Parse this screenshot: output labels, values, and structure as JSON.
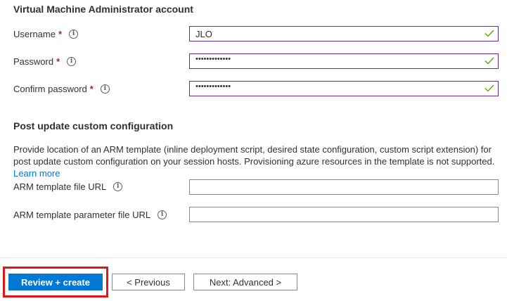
{
  "vm_admin": {
    "title": "Virtual Machine Administrator account",
    "username": {
      "label": "Username",
      "required_mark": "*",
      "value": "JLO"
    },
    "password": {
      "label": "Password",
      "required_mark": "*",
      "value": "•••••••••••••"
    },
    "confirm_password": {
      "label": "Confirm password",
      "required_mark": "*",
      "value": "•••••••••••••"
    }
  },
  "post_update": {
    "title": "Post update custom configuration",
    "description": "Provide location of an ARM template (inline deployment script, desired state configuration, custom script extension) for post update custom configuration on your session hosts. Provisioning azure resources in the template is not supported.",
    "learn_more": "Learn more",
    "arm_template_url": {
      "label": "ARM template file URL",
      "value": ""
    },
    "arm_param_url": {
      "label": "ARM template parameter file URL",
      "value": ""
    }
  },
  "footer": {
    "review_create": "Review + create",
    "previous": "< Previous",
    "next": "Next: Advanced >"
  },
  "icons": {
    "info": "info-icon",
    "valid": "checkmark-icon"
  },
  "colors": {
    "primary": "#0078d4",
    "required": "#a4262c",
    "valid": "#57a300",
    "highlight": "#e0161b",
    "focus_border": "#6b2a9a"
  }
}
